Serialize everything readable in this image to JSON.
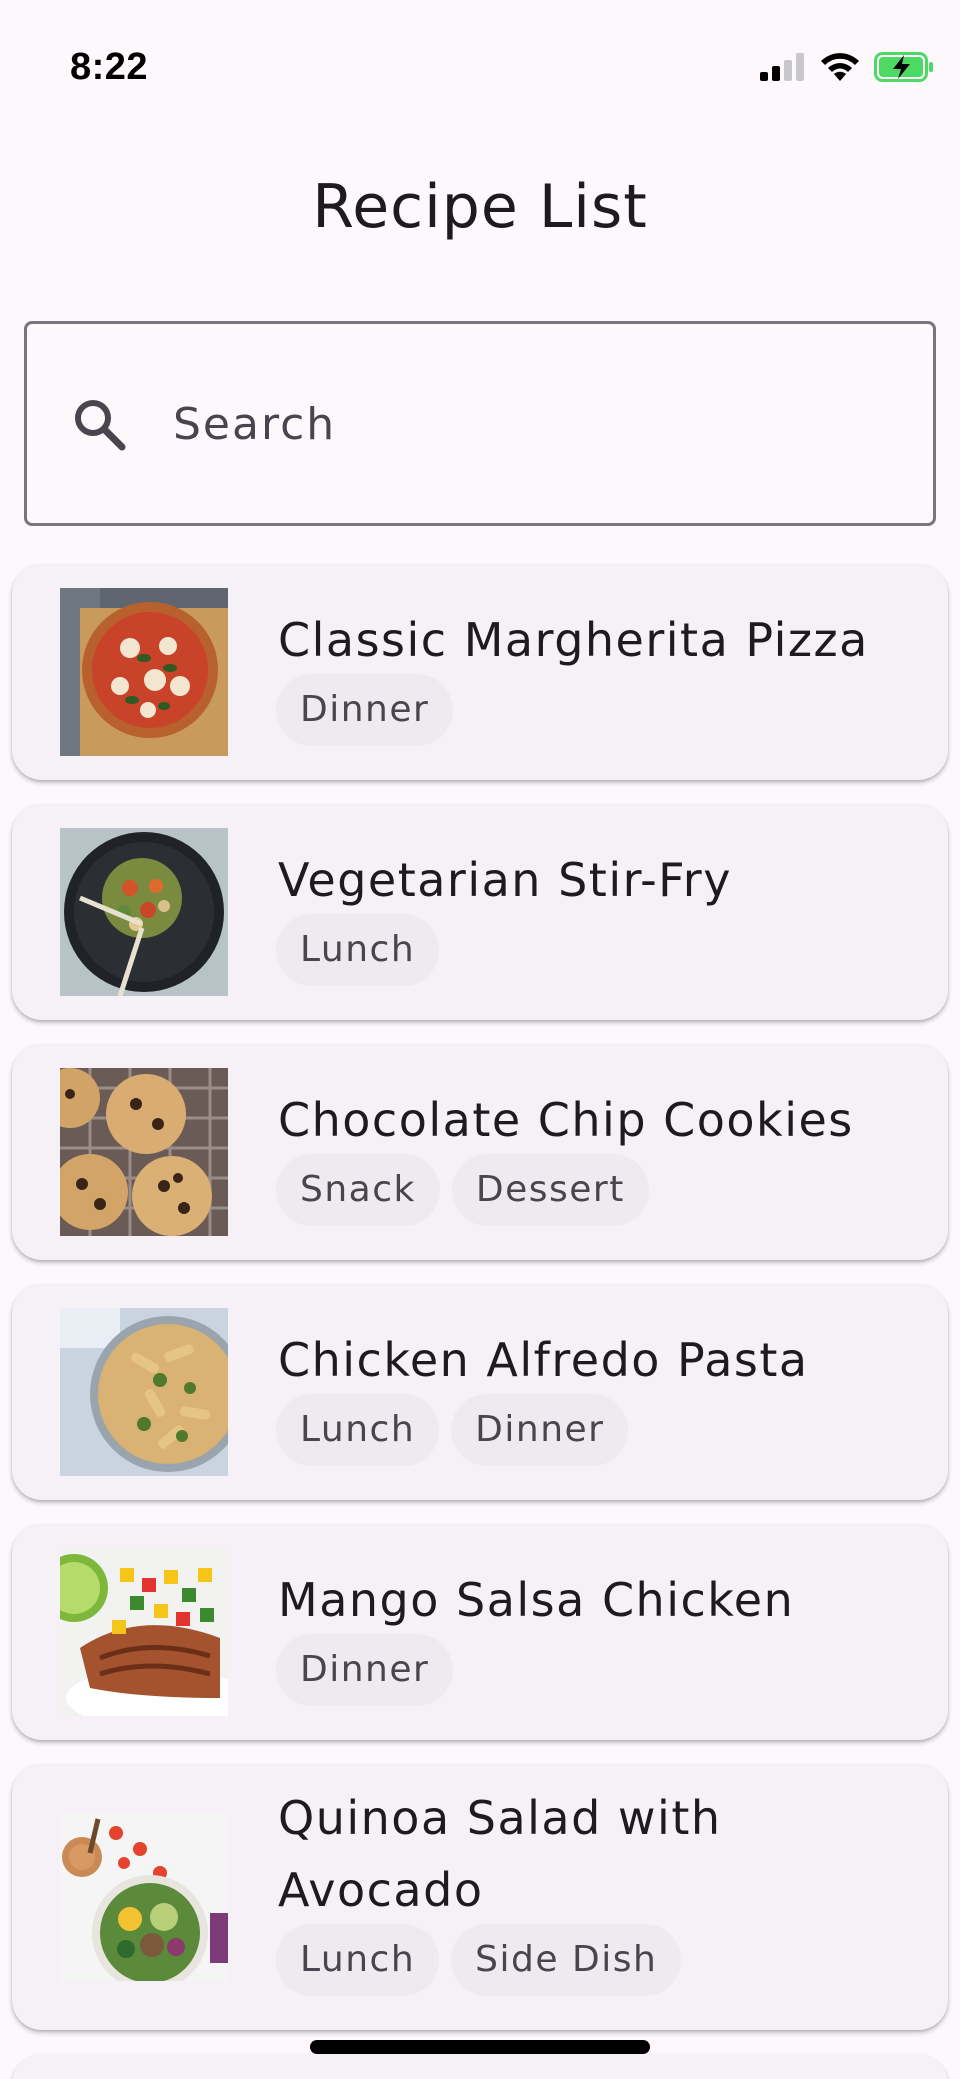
{
  "status_bar": {
    "time": "8:22",
    "icons": [
      "cellular-signal-icon",
      "wifi-icon",
      "battery-charging-icon"
    ],
    "battery_color": "#4cd964"
  },
  "header": {
    "title": "Recipe List"
  },
  "search": {
    "placeholder": "Search",
    "value": "",
    "icon": "search-icon"
  },
  "recipes": [
    {
      "title": "Classic Margherita Pizza",
      "tags": [
        "Dinner"
      ],
      "image": "pizza-photo"
    },
    {
      "title": "Vegetarian Stir-Fry",
      "tags": [
        "Lunch"
      ],
      "image": "stir-fry-photo"
    },
    {
      "title": "Chocolate Chip Cookies",
      "tags": [
        "Snack",
        "Dessert"
      ],
      "image": "cookies-photo"
    },
    {
      "title": "Chicken Alfredo Pasta",
      "tags": [
        "Lunch",
        "Dinner"
      ],
      "image": "pasta-photo"
    },
    {
      "title": "Mango Salsa Chicken",
      "tags": [
        "Dinner"
      ],
      "image": "mango-chicken-photo"
    },
    {
      "title": "Quinoa Salad with Avocado",
      "tags": [
        "Lunch",
        "Side Dish"
      ],
      "image": "quinoa-salad-photo"
    }
  ],
  "colors": {
    "background": "#fdf8fc",
    "card": "#f6f1f7",
    "chip": "#efeaf0",
    "outline": "#79747e"
  }
}
